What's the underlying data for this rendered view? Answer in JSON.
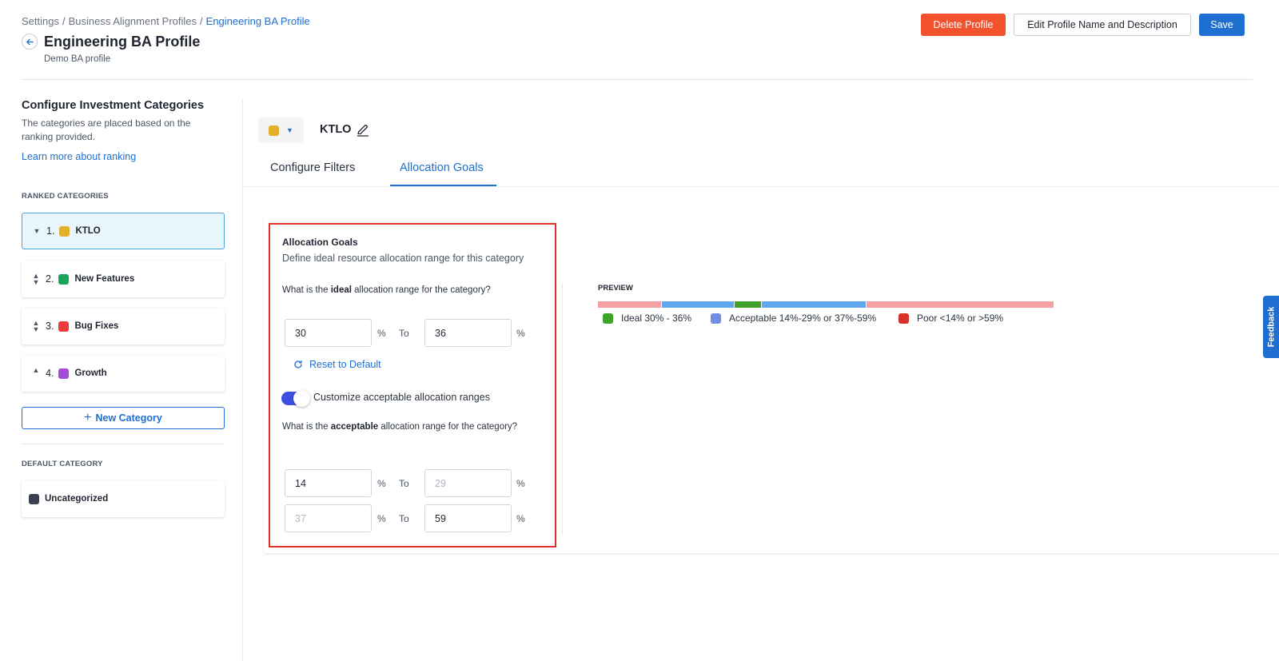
{
  "header": {
    "breadcrumb": [
      "Settings",
      "Business Alignment Profiles",
      "Engineering BA Profile"
    ],
    "breadcrumb_sep": "/",
    "title": "Engineering BA Profile",
    "subtitle": "Demo BA profile",
    "buttons": {
      "delete": "Delete Profile",
      "edit": "Edit Profile Name and Description",
      "save": "Save"
    }
  },
  "sidebar": {
    "title": "Configure Investment Categories",
    "description": "The categories are placed based on the ranking provided.",
    "learn_more": "Learn more about ranking",
    "ranked_label": "RANKED CATEGORIES",
    "categories": [
      {
        "rank": "1.",
        "label": "KTLO",
        "color": "#e1b12c"
      },
      {
        "rank": "2.",
        "label": "New Features",
        "color": "#17a55a"
      },
      {
        "rank": "3.",
        "label": "Bug Fixes",
        "color": "#ef3b3b"
      },
      {
        "rank": "4.",
        "label": "Growth",
        "color": "#a24fd6"
      }
    ],
    "new_category": "New Category",
    "default_label": "DEFAULT CATEGORY",
    "default_category": {
      "label": "Uncategorized",
      "color": "#3a3f52"
    }
  },
  "editor": {
    "category_name": "KTLO",
    "category_color": "#e1b12c",
    "tabs": [
      "Configure Filters",
      "Allocation Goals"
    ],
    "active_tab": "Allocation Goals"
  },
  "allocation": {
    "title": "Allocation Goals",
    "description": "Define ideal resource allocation range for this category",
    "ideal_question_pre": "What is the ",
    "ideal_question_bold": "ideal",
    "ideal_question_post": " allocation range for the category?",
    "ideal_min": "30",
    "ideal_max": "36",
    "percent": "%",
    "to": "To",
    "reset": "Reset to Default",
    "toggle_on": true,
    "toggle_label": "Customize acceptable allocation ranges",
    "acceptable_question_pre": "What is the ",
    "acceptable_question_bold": "acceptable",
    "acceptable_question_post": " allocation range for the category?",
    "acceptable_low_min": "14",
    "acceptable_low_max_placeholder": "29",
    "acceptable_high_min_placeholder": "37",
    "acceptable_high_max": "59"
  },
  "preview": {
    "label": "PREVIEW",
    "bar": [
      {
        "from": 0,
        "to": 14,
        "status": "poor",
        "color": "#f4a0a4"
      },
      {
        "from": 14,
        "to": 30,
        "status": "acceptable",
        "color": "#5da8f0"
      },
      {
        "from": 30,
        "to": 36,
        "status": "ideal",
        "color": "#3ea22a"
      },
      {
        "from": 36,
        "to": 59,
        "status": "acceptable",
        "color": "#5da8f0"
      },
      {
        "from": 59,
        "to": 100,
        "status": "poor",
        "color": "#f4a0a4"
      }
    ],
    "legend": [
      {
        "label": "Ideal 30% - 36%",
        "color": "#3ea22a"
      },
      {
        "label": "Acceptable 14%-29% or 37%-59%",
        "color": "#6e8de6"
      },
      {
        "label": "Poor <14% or >59%",
        "color": "#d8302a"
      }
    ]
  },
  "feedback": "Feedback"
}
